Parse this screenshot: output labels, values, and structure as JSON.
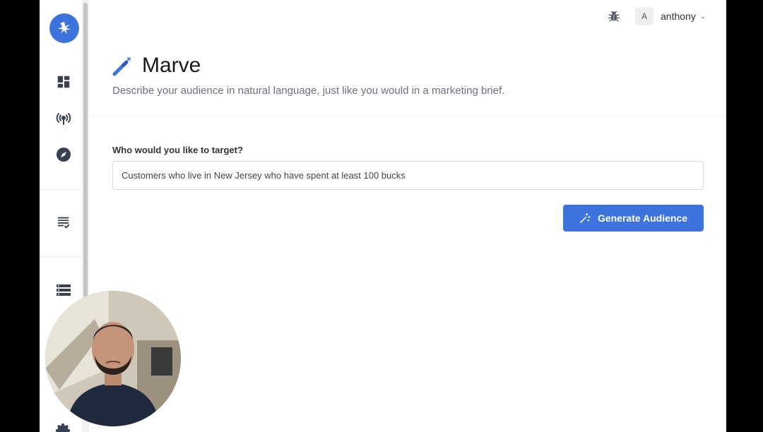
{
  "app": {
    "title": "Marve",
    "subtitle": "Describe your audience in natural language, just like you would in a marketing brief."
  },
  "sidebar": {
    "items": [
      {
        "name": "dashboard-icon"
      },
      {
        "name": "broadcast-icon"
      },
      {
        "name": "compass-icon"
      },
      {
        "name": "checklist-icon"
      },
      {
        "name": "database-icon"
      },
      {
        "name": "gear-icon"
      }
    ]
  },
  "topbar": {
    "avatar_initial": "A",
    "username": "anthony",
    "chevron": "⌄"
  },
  "form": {
    "label": "Who would you like to target?",
    "input_value": "Customers who live in New Jersey who have spent at least 100 bucks"
  },
  "actions": {
    "generate_label": "Generate Audience"
  },
  "colors": {
    "accent": "#3d73dc",
    "sidebar_icon": "#374151"
  }
}
